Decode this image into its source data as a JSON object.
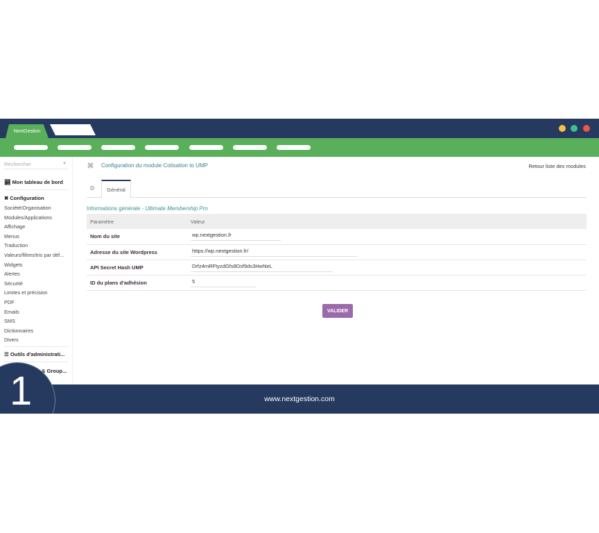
{
  "header": {
    "brand_tab": "NextGestion",
    "window_dots": [
      "#f5c242",
      "#3dbf8f",
      "#e8574a"
    ]
  },
  "sidebar": {
    "search_placeholder": "Rechercher",
    "dashboard": "Mon tableau de bord",
    "config_heading": "Configuration",
    "items": [
      "Société/Organisation",
      "Modules/Applications",
      "Affichage",
      "Menus",
      "Traduction",
      "Valeurs/filtres/tris par déf...",
      "Widgets",
      "Alertes",
      "Sécurité",
      "Limites et précision",
      "PDF",
      "Emails",
      "SMS",
      "Dictionnaires",
      "Divers"
    ],
    "admin_tools": "Outils d'administrati...",
    "users_groups": "& Group..."
  },
  "main": {
    "title": "Configuration du module Cotisation to UMP",
    "back_link": "Retour liste des modules",
    "tab": "Général",
    "section_prefix": "Informations générale - ",
    "section_italic": "Ultimate Membership Pro",
    "table": {
      "headers": [
        "Paramètre",
        "Valeur"
      ],
      "rows": [
        {
          "label": "Nom du site",
          "value": "wp.nextgestion.fr"
        },
        {
          "label": "Adresse du site Wordpress",
          "value": "https://wp.nextgestion.fr/"
        },
        {
          "label": "API Secret Hash UMP",
          "value": "Drfz4mRFtyzdGfs8Dsf9ds3HwNeL"
        },
        {
          "label": "ID du plans d'adhésion",
          "value": "5"
        }
      ]
    },
    "submit": "VALIDER"
  },
  "footer": {
    "url": "www.nextgestion.com"
  },
  "step_number": "1"
}
